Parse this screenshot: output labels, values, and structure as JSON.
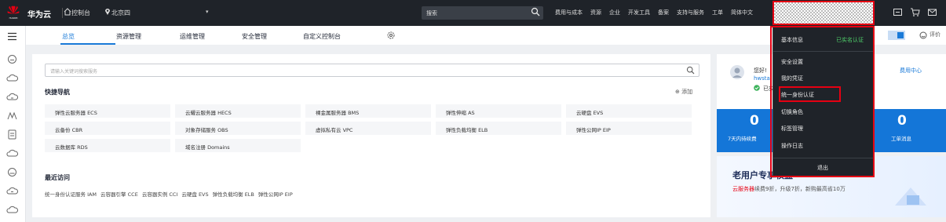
{
  "topbar": {
    "brand": "华为云",
    "console": "控制台",
    "region": "北京四",
    "search_placeholder": "搜索",
    "links": [
      "费用与成本",
      "资源",
      "企业",
      "开发工具",
      "备案",
      "支持与服务",
      "工单",
      "简体中文"
    ]
  },
  "tabs": {
    "items": [
      "总览",
      "资源管理",
      "运维管理",
      "安全管理",
      "自定义控制台"
    ],
    "rating": "评价"
  },
  "main": {
    "search_placeholder": "请输入关键词搜索服务",
    "quick_nav_title": "快捷导航",
    "add_label": "添加",
    "services": [
      [
        "弹性云服务器 ECS",
        "云耀云服务器 HECS",
        "裸金属服务器 BMS",
        "弹性伸缩 AS",
        "云硬盘 EVS"
      ],
      [
        "云备份 CBR",
        "对象存储服务 OBS",
        "虚拟私有云 VPC",
        "弹性负载均衡 ELB",
        "弹性公网IP EIP"
      ],
      [
        "云数据库 RDS",
        "域名注册 Domains"
      ]
    ],
    "recent_title": "最近访问",
    "recent": [
      "统一身份认证服务 IAM",
      "云容器引擎 CCE",
      "云容器实例 CCI",
      "云硬盘 EVS",
      "弹性负载均衡 ELB",
      "弹性公网IP EIP"
    ]
  },
  "profile": {
    "hello": "您好!",
    "user_prefix": "hwsta",
    "user_suffix": "hui",
    "verified_short": "已实",
    "fee_center": "费用中心",
    "stat_left_value": "0",
    "stat_left_label": "7天内待续费",
    "stat_right_value": "0",
    "stat_right_label": "工单消息",
    "promo_title": "老用户专享权益 →",
    "promo_red": "云服务器",
    "promo_rest": "续费9折，升级7折，新购最高省10万"
  },
  "account_menu": {
    "basic_info": "基本信息",
    "verified": "已实名认证",
    "items": [
      "安全设置",
      "我的凭证",
      "统一身份认证",
      "切换角色",
      "标签管理",
      "操作日志"
    ],
    "logout": "退出"
  }
}
